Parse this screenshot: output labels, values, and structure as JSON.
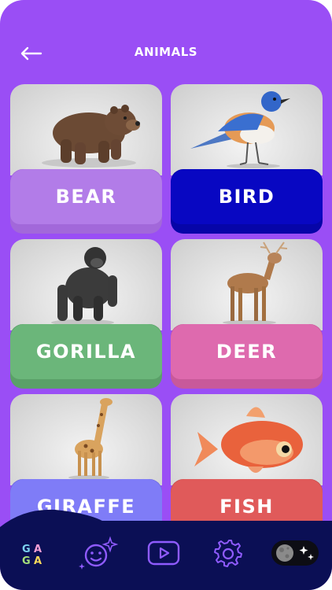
{
  "header": {
    "title": "ANIMALS",
    "back_icon": "arrow-left-icon"
  },
  "colors": {
    "background": "#9a4ef5",
    "nav_bg": "#0b0f55",
    "accent_icon": "#8f5bff"
  },
  "cards": [
    {
      "label": "BEAR",
      "color": "#b27ce8",
      "icon": "bear-image"
    },
    {
      "label": "BIRD",
      "color": "#0807c2",
      "icon": "bird-image"
    },
    {
      "label": "GORILLA",
      "color": "#6bb67a",
      "icon": "gorilla-image"
    },
    {
      "label": "DEER",
      "color": "#de6aae",
      "icon": "deer-image"
    },
    {
      "label": "GIRAFFE",
      "color": "#7f7cf7",
      "icon": "giraffe-image"
    },
    {
      "label": "FISH",
      "color": "#e05a5a",
      "icon": "fish-image"
    }
  ],
  "nav": {
    "items": [
      {
        "name": "gaga-logo",
        "icon": "gaga-logo-icon"
      },
      {
        "name": "emoji-face",
        "icon": "smiley-sparkle-icon"
      },
      {
        "name": "video",
        "icon": "play-icon"
      },
      {
        "name": "settings",
        "icon": "gear-icon"
      },
      {
        "name": "theme-toggle",
        "icon": "moon-toggle-icon"
      }
    ],
    "logo_letters": [
      "G",
      "A",
      "G",
      "A"
    ]
  }
}
